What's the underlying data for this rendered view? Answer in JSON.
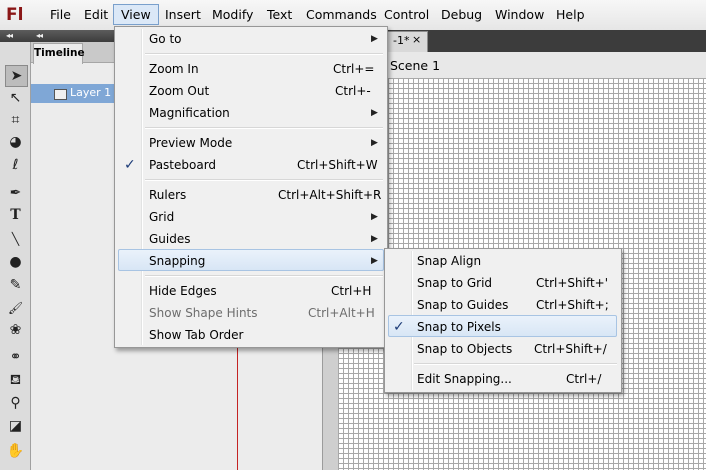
{
  "app": {
    "logo": "Fl"
  },
  "menubar": {
    "items": [
      "File",
      "Edit",
      "View",
      "Insert",
      "Modify",
      "Text",
      "Commands",
      "Control",
      "Debug",
      "Window",
      "Help"
    ],
    "active": "View"
  },
  "panels": {
    "collapse_glyph": "◂◂",
    "timeline_tab": "Timeline",
    "layer_name": "Layer 1"
  },
  "document": {
    "tab_label": "-1*",
    "tab_close": "×",
    "scene_label": "Scene 1"
  },
  "tools": [
    {
      "name": "selection-tool",
      "glyph": "➤"
    },
    {
      "name": "subselection-tool",
      "glyph": "↖"
    },
    {
      "name": "free-transform-tool",
      "glyph": "⌗"
    },
    {
      "name": "3d-rotation-tool",
      "glyph": "◕"
    },
    {
      "name": "lasso-tool",
      "glyph": "ℓ"
    },
    {
      "name": "pen-tool",
      "glyph": "✒"
    },
    {
      "name": "text-tool",
      "glyph": "T"
    },
    {
      "name": "line-tool",
      "glyph": "╲"
    },
    {
      "name": "oval-tool",
      "glyph": "●"
    },
    {
      "name": "pencil-tool",
      "glyph": "✎"
    },
    {
      "name": "brush-tool",
      "glyph": "🖌"
    },
    {
      "name": "deco-tool",
      "glyph": "❀"
    },
    {
      "name": "bone-tool",
      "glyph": "⚭"
    },
    {
      "name": "paint-bucket-tool",
      "glyph": "⛾"
    },
    {
      "name": "eyedropper-tool",
      "glyph": "⚲"
    },
    {
      "name": "eraser-tool",
      "glyph": "◪"
    },
    {
      "name": "hand-tool",
      "glyph": "✋"
    }
  ],
  "view_menu": {
    "items": [
      {
        "label": "Go to",
        "submenu": true
      },
      {
        "label": "Zoom In",
        "shortcut": "Ctrl+="
      },
      {
        "label": "Zoom Out",
        "shortcut": "Ctrl+-"
      },
      {
        "label": "Magnification",
        "submenu": true
      },
      {
        "label": "Preview Mode",
        "submenu": true
      },
      {
        "label": "Pasteboard",
        "shortcut": "Ctrl+Shift+W",
        "checked": true
      },
      {
        "label": "Rulers",
        "shortcut": "Ctrl+Alt+Shift+R"
      },
      {
        "label": "Grid",
        "submenu": true
      },
      {
        "label": "Guides",
        "submenu": true
      },
      {
        "label": "Snapping",
        "submenu": true,
        "highlighted": true
      },
      {
        "label": "Hide Edges",
        "shortcut": "Ctrl+H"
      },
      {
        "label": "Show Shape Hints",
        "shortcut": "Ctrl+Alt+H",
        "disabled": true
      },
      {
        "label": "Show Tab Order"
      }
    ]
  },
  "snapping_menu": {
    "items": [
      {
        "label": "Snap Align"
      },
      {
        "label": "Snap to Grid",
        "shortcut": "Ctrl+Shift+'"
      },
      {
        "label": "Snap to Guides",
        "shortcut": "Ctrl+Shift+;"
      },
      {
        "label": "Snap to Pixels",
        "checked": true,
        "highlighted": true
      },
      {
        "label": "Snap to Objects",
        "shortcut": "Ctrl+Shift+/"
      },
      {
        "label": "Edit Snapping...",
        "shortcut": "Ctrl+/"
      }
    ]
  },
  "glyphs": {
    "check": "✓",
    "submenu_arrow": "▶"
  },
  "colors": {
    "highlight": "#d8e6f5",
    "layer_selected": "#7fa7d6",
    "logo": "#8a1616",
    "playhead": "#c42323"
  }
}
